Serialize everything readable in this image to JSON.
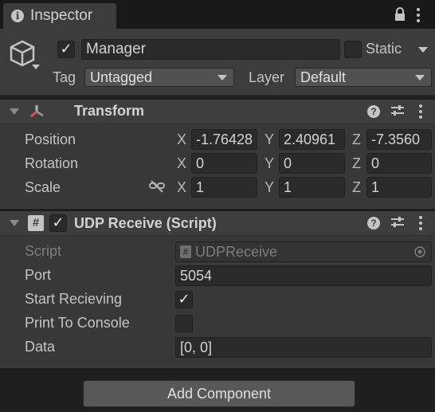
{
  "tab": {
    "title": "Inspector",
    "info_icon": "info-icon",
    "lock_icon": "lock-icon",
    "menu_icon": "kebab-menu-icon"
  },
  "gameobject": {
    "active": true,
    "name": "Manager",
    "static_label": "Static",
    "static_checked": false,
    "tag_label": "Tag",
    "tag_value": "Untagged",
    "layer_label": "Layer",
    "layer_value": "Default"
  },
  "transform": {
    "title": "Transform",
    "rows": [
      {
        "label": "Position",
        "x": "-1.76428",
        "y": "2.40961",
        "z": "-7.3560"
      },
      {
        "label": "Rotation",
        "x": "0",
        "y": "0",
        "z": "0"
      },
      {
        "label": "Scale",
        "x": "1",
        "y": "1",
        "z": "1"
      }
    ],
    "axis_x": "X",
    "axis_y": "Y",
    "axis_z": "Z"
  },
  "udp": {
    "title": "UDP Receive (Script)",
    "enabled": true,
    "script_label": "Script",
    "script_value": "UDPReceive",
    "port_label": "Port",
    "port_value": "5054",
    "start_label": "Start Recieving",
    "start_checked": true,
    "print_label": "Print To Console",
    "print_checked": false,
    "data_label": "Data",
    "data_value": "[0, 0]"
  },
  "add_component": "Add Component",
  "check_glyph": "✓"
}
